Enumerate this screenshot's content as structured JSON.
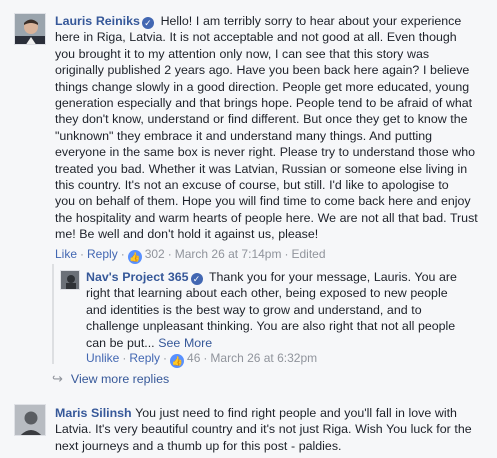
{
  "comments": [
    {
      "author": "Lauris Reiniks",
      "text_lines": [
        "Hello! I am terribly sorry to hear about your experience",
        "here in Riga, Latvia. It is not acceptable and not good at all. Even though",
        "you brought it to my attention only now, I can see that this story was",
        "originally published 2 years ago. Have you been back here again? I believe",
        "things change slowly in a good direction. People get more educated, young",
        "generation especially and that brings hope. People tend to be afraid of what",
        "they don't know, understand or find different. But once they get to know the",
        "\"unknown\" they embrace it and understand many things. And putting",
        "everyone in the same box is never right. Please try to understand those who",
        "treated you bad. Whether it was Latvian, Russian or someone else living in",
        "this country. It's not an excuse of course, but still. I'd like to apologise to",
        "you on behalf of them. Hope you will find time to come back here and enjoy",
        "the hospitality and warm hearts of people here. We are not all that bad. Trust",
        "me! Be well and don't hold it against us, please!"
      ],
      "actions": {
        "like": "Like",
        "reply": "Reply",
        "reaction_count": "302",
        "timestamp": "March 26 at 7:14pm",
        "edited": "Edited"
      }
    },
    {
      "author": "Nav's Project 365",
      "text_lines": [
        "Thank you for your message, Lauris. You are",
        "right that learning about each other, being exposed to new people",
        "and identities is the best way to grow and understand, and to",
        "challenge unpleasant thinking. You are also right that not all people",
        "can be put..."
      ],
      "see_more": "See More",
      "actions": {
        "unlike": "Unlike",
        "reply": "Reply",
        "reaction_count": "46",
        "timestamp": "March 26 at 6:32pm"
      }
    },
    {
      "author": "Maris Silinsh",
      "text_lines": [
        "You just need to find right people and you'll fall in love with",
        "Latvia. It's very beautiful country and it's not just Riga. Wish You luck for the",
        "next journeys and a thumb up for this post - paldies."
      ]
    }
  ],
  "view_more_replies": "View more replies",
  "icons": {
    "verified": "check-badge-icon",
    "like": "thumbs-up-icon",
    "reply_arrow": "reply-arrow-icon"
  },
  "colors": {
    "name": "#365899",
    "link": "#4267b2",
    "meta": "#90949c",
    "like_badge": "#5890ff"
  }
}
